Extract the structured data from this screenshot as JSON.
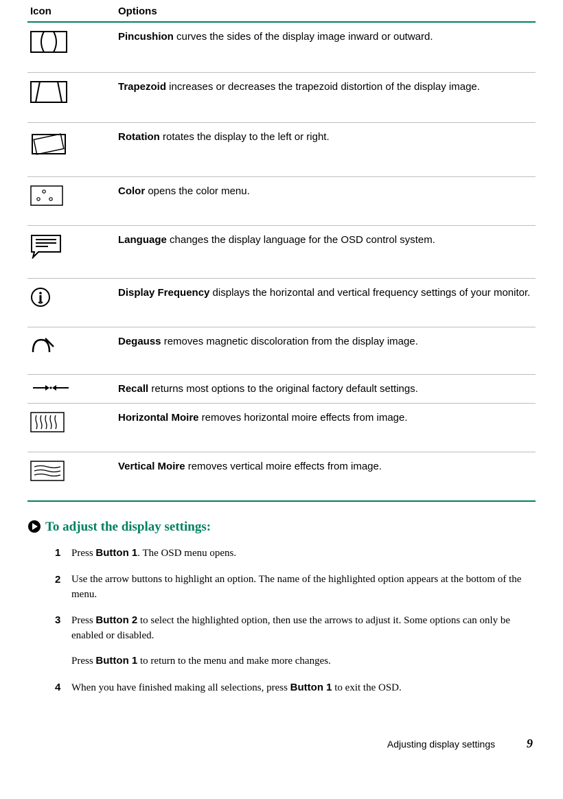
{
  "table": {
    "header_icon": "Icon",
    "header_options": "Options",
    "rows": [
      {
        "bold": "Pincushion",
        "rest": " curves the sides of the display image inward or outward."
      },
      {
        "bold": "Trapezoid",
        "rest": " increases or decreases the trapezoid distortion of the display image."
      },
      {
        "bold": "Rotation",
        "rest": " rotates the display to the left or right."
      },
      {
        "bold": "Color",
        "rest": " opens the color menu."
      },
      {
        "bold": "Language",
        "rest": " changes the display language for the OSD control system."
      },
      {
        "bold": "Display Frequency",
        "rest": " displays the horizontal and vertical frequency settings of your monitor."
      },
      {
        "bold": "Degauss",
        "rest": " removes magnetic discoloration from the display image."
      },
      {
        "bold": "Recall",
        "rest": " returns most options to the original factory default settings."
      },
      {
        "bold": "Horizontal Moire",
        "rest": " removes horizontal moire effects from image."
      },
      {
        "bold": "Vertical Moire",
        "rest": " removes vertical moire effects from image."
      }
    ]
  },
  "section_title": "To adjust the display settings:",
  "steps": [
    {
      "num": "1",
      "paras": [
        {
          "pre": "Press ",
          "bold": "Button 1",
          "post": ". The OSD menu opens."
        }
      ]
    },
    {
      "num": "2",
      "paras": [
        {
          "pre": "Use the arrow buttons to highlight an option. The name of the highlighted option appears at the bottom of the menu.",
          "bold": "",
          "post": ""
        }
      ]
    },
    {
      "num": "3",
      "paras": [
        {
          "pre": "Press ",
          "bold": "Button 2",
          "post": " to select the highlighted option, then use the arrows to adjust it. Some options can only be enabled or disabled."
        },
        {
          "pre": "Press ",
          "bold": "Button 1",
          "post": " to return to the menu and make more changes."
        }
      ]
    },
    {
      "num": "4",
      "paras": [
        {
          "pre": "When you have finished making all selections, press ",
          "bold": "Button 1",
          "post": " to exit the OSD."
        }
      ]
    }
  ],
  "footer_text": "Adjusting display settings",
  "footer_page": "9"
}
